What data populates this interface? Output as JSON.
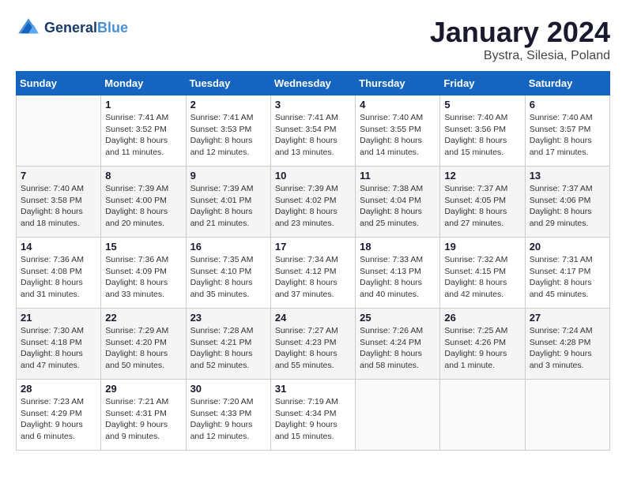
{
  "logo": {
    "line1": "General",
    "line2": "Blue"
  },
  "title": "January 2024",
  "subtitle": "Bystra, Silesia, Poland",
  "weekdays": [
    "Sunday",
    "Monday",
    "Tuesday",
    "Wednesday",
    "Thursday",
    "Friday",
    "Saturday"
  ],
  "weeks": [
    [
      {
        "day": "",
        "sunrise": "",
        "sunset": "",
        "daylight": ""
      },
      {
        "day": "1",
        "sunrise": "Sunrise: 7:41 AM",
        "sunset": "Sunset: 3:52 PM",
        "daylight": "Daylight: 8 hours and 11 minutes."
      },
      {
        "day": "2",
        "sunrise": "Sunrise: 7:41 AM",
        "sunset": "Sunset: 3:53 PM",
        "daylight": "Daylight: 8 hours and 12 minutes."
      },
      {
        "day": "3",
        "sunrise": "Sunrise: 7:41 AM",
        "sunset": "Sunset: 3:54 PM",
        "daylight": "Daylight: 8 hours and 13 minutes."
      },
      {
        "day": "4",
        "sunrise": "Sunrise: 7:40 AM",
        "sunset": "Sunset: 3:55 PM",
        "daylight": "Daylight: 8 hours and 14 minutes."
      },
      {
        "day": "5",
        "sunrise": "Sunrise: 7:40 AM",
        "sunset": "Sunset: 3:56 PM",
        "daylight": "Daylight: 8 hours and 15 minutes."
      },
      {
        "day": "6",
        "sunrise": "Sunrise: 7:40 AM",
        "sunset": "Sunset: 3:57 PM",
        "daylight": "Daylight: 8 hours and 17 minutes."
      }
    ],
    [
      {
        "day": "7",
        "sunrise": "Sunrise: 7:40 AM",
        "sunset": "Sunset: 3:58 PM",
        "daylight": "Daylight: 8 hours and 18 minutes."
      },
      {
        "day": "8",
        "sunrise": "Sunrise: 7:39 AM",
        "sunset": "Sunset: 4:00 PM",
        "daylight": "Daylight: 8 hours and 20 minutes."
      },
      {
        "day": "9",
        "sunrise": "Sunrise: 7:39 AM",
        "sunset": "Sunset: 4:01 PM",
        "daylight": "Daylight: 8 hours and 21 minutes."
      },
      {
        "day": "10",
        "sunrise": "Sunrise: 7:39 AM",
        "sunset": "Sunset: 4:02 PM",
        "daylight": "Daylight: 8 hours and 23 minutes."
      },
      {
        "day": "11",
        "sunrise": "Sunrise: 7:38 AM",
        "sunset": "Sunset: 4:04 PM",
        "daylight": "Daylight: 8 hours and 25 minutes."
      },
      {
        "day": "12",
        "sunrise": "Sunrise: 7:37 AM",
        "sunset": "Sunset: 4:05 PM",
        "daylight": "Daylight: 8 hours and 27 minutes."
      },
      {
        "day": "13",
        "sunrise": "Sunrise: 7:37 AM",
        "sunset": "Sunset: 4:06 PM",
        "daylight": "Daylight: 8 hours and 29 minutes."
      }
    ],
    [
      {
        "day": "14",
        "sunrise": "Sunrise: 7:36 AM",
        "sunset": "Sunset: 4:08 PM",
        "daylight": "Daylight: 8 hours and 31 minutes."
      },
      {
        "day": "15",
        "sunrise": "Sunrise: 7:36 AM",
        "sunset": "Sunset: 4:09 PM",
        "daylight": "Daylight: 8 hours and 33 minutes."
      },
      {
        "day": "16",
        "sunrise": "Sunrise: 7:35 AM",
        "sunset": "Sunset: 4:10 PM",
        "daylight": "Daylight: 8 hours and 35 minutes."
      },
      {
        "day": "17",
        "sunrise": "Sunrise: 7:34 AM",
        "sunset": "Sunset: 4:12 PM",
        "daylight": "Daylight: 8 hours and 37 minutes."
      },
      {
        "day": "18",
        "sunrise": "Sunrise: 7:33 AM",
        "sunset": "Sunset: 4:13 PM",
        "daylight": "Daylight: 8 hours and 40 minutes."
      },
      {
        "day": "19",
        "sunrise": "Sunrise: 7:32 AM",
        "sunset": "Sunset: 4:15 PM",
        "daylight": "Daylight: 8 hours and 42 minutes."
      },
      {
        "day": "20",
        "sunrise": "Sunrise: 7:31 AM",
        "sunset": "Sunset: 4:17 PM",
        "daylight": "Daylight: 8 hours and 45 minutes."
      }
    ],
    [
      {
        "day": "21",
        "sunrise": "Sunrise: 7:30 AM",
        "sunset": "Sunset: 4:18 PM",
        "daylight": "Daylight: 8 hours and 47 minutes."
      },
      {
        "day": "22",
        "sunrise": "Sunrise: 7:29 AM",
        "sunset": "Sunset: 4:20 PM",
        "daylight": "Daylight: 8 hours and 50 minutes."
      },
      {
        "day": "23",
        "sunrise": "Sunrise: 7:28 AM",
        "sunset": "Sunset: 4:21 PM",
        "daylight": "Daylight: 8 hours and 52 minutes."
      },
      {
        "day": "24",
        "sunrise": "Sunrise: 7:27 AM",
        "sunset": "Sunset: 4:23 PM",
        "daylight": "Daylight: 8 hours and 55 minutes."
      },
      {
        "day": "25",
        "sunrise": "Sunrise: 7:26 AM",
        "sunset": "Sunset: 4:24 PM",
        "daylight": "Daylight: 8 hours and 58 minutes."
      },
      {
        "day": "26",
        "sunrise": "Sunrise: 7:25 AM",
        "sunset": "Sunset: 4:26 PM",
        "daylight": "Daylight: 9 hours and 1 minute."
      },
      {
        "day": "27",
        "sunrise": "Sunrise: 7:24 AM",
        "sunset": "Sunset: 4:28 PM",
        "daylight": "Daylight: 9 hours and 3 minutes."
      }
    ],
    [
      {
        "day": "28",
        "sunrise": "Sunrise: 7:23 AM",
        "sunset": "Sunset: 4:29 PM",
        "daylight": "Daylight: 9 hours and 6 minutes."
      },
      {
        "day": "29",
        "sunrise": "Sunrise: 7:21 AM",
        "sunset": "Sunset: 4:31 PM",
        "daylight": "Daylight: 9 hours and 9 minutes."
      },
      {
        "day": "30",
        "sunrise": "Sunrise: 7:20 AM",
        "sunset": "Sunset: 4:33 PM",
        "daylight": "Daylight: 9 hours and 12 minutes."
      },
      {
        "day": "31",
        "sunrise": "Sunrise: 7:19 AM",
        "sunset": "Sunset: 4:34 PM",
        "daylight": "Daylight: 9 hours and 15 minutes."
      },
      {
        "day": "",
        "sunrise": "",
        "sunset": "",
        "daylight": ""
      },
      {
        "day": "",
        "sunrise": "",
        "sunset": "",
        "daylight": ""
      },
      {
        "day": "",
        "sunrise": "",
        "sunset": "",
        "daylight": ""
      }
    ]
  ]
}
